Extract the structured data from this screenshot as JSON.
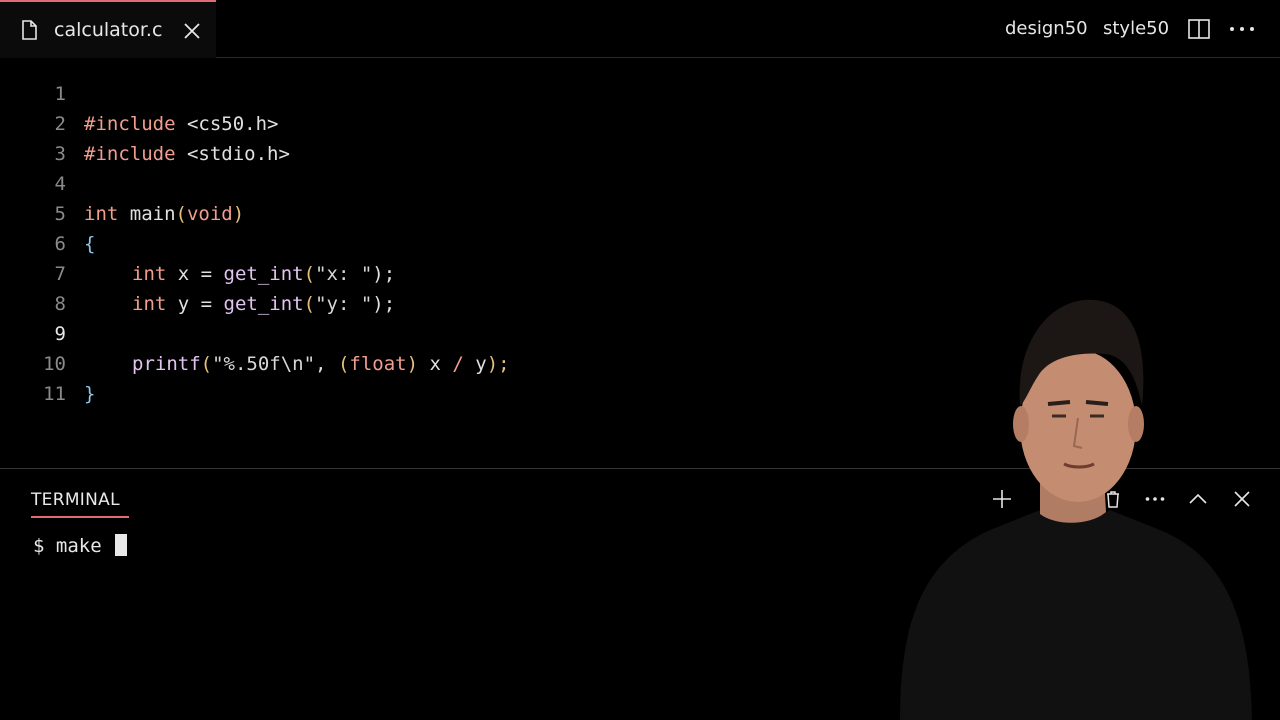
{
  "tab": {
    "filename": "calculator.c"
  },
  "header_actions": {
    "design": "design50",
    "style": "style50"
  },
  "editor": {
    "active_line": 9,
    "lines": [
      {
        "n": "1"
      },
      {
        "n": "2"
      },
      {
        "n": "3"
      },
      {
        "n": "4"
      },
      {
        "n": "5"
      },
      {
        "n": "6"
      },
      {
        "n": "7"
      },
      {
        "n": "8"
      },
      {
        "n": "9"
      },
      {
        "n": "10"
      },
      {
        "n": "11"
      }
    ],
    "code": {
      "l1": [
        "#include",
        " <cs50.h>"
      ],
      "l2": [
        "#include",
        " <stdio.h>"
      ],
      "l4": [
        "int",
        " main",
        "(",
        "void",
        ")"
      ],
      "l5": [
        "{"
      ],
      "l6": [
        "int",
        " x = ",
        "get_int",
        "(",
        "\"x: \"",
        ");"
      ],
      "l7": [
        "int",
        " y = ",
        "get_int",
        "(",
        "\"y: \"",
        ");"
      ],
      "l9": [
        "printf",
        "(",
        "\"%.50f\\n\"",
        ", ",
        "(",
        "float",
        ")",
        " x ",
        "/",
        " y",
        ");"
      ],
      "l10": [
        "}"
      ]
    }
  },
  "terminal": {
    "tab_label": "TERMINAL",
    "prompt": "$ make "
  },
  "colors": {
    "accent": "#e06c75",
    "keyword": "#f29e8e",
    "function": "#e2c4f0",
    "brace": "#8fc4e8",
    "paren": "#e6c07b"
  }
}
